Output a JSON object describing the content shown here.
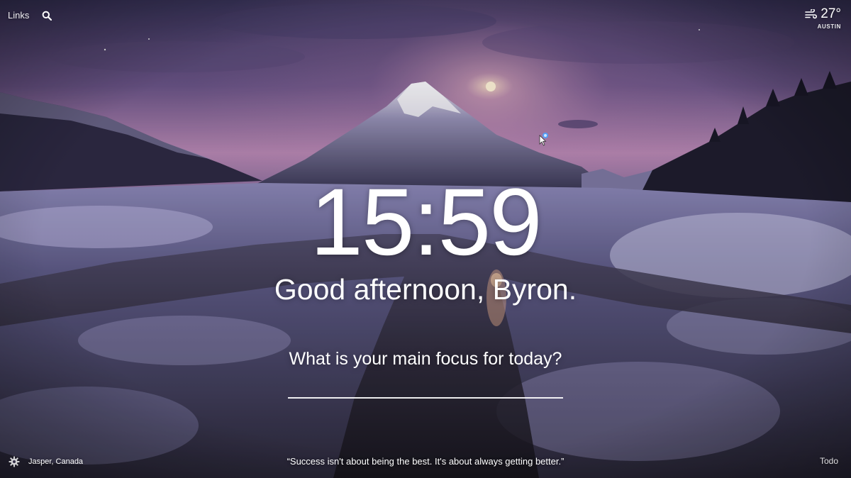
{
  "header": {
    "links_label": "Links",
    "search_icon": "search-icon"
  },
  "weather": {
    "icon": "wind-icon",
    "temperature": "27°",
    "location": "AUSTIN"
  },
  "main": {
    "time": "15:59",
    "greeting": "Good afternoon, Byron.",
    "focus_question": "What is your main focus for today?",
    "focus_input_value": ""
  },
  "footer": {
    "settings_icon": "gear-icon",
    "photo_location": "Jasper, Canada",
    "quote": "“Success isn't about being the best. It's about always getting better.”",
    "todo_label": "Todo"
  },
  "colors": {
    "sky_top": "#4a3f6b",
    "sky_glow": "#c88ab8",
    "snow": "#c9c6e6",
    "water": "#1a1822",
    "text": "#ffffff"
  }
}
